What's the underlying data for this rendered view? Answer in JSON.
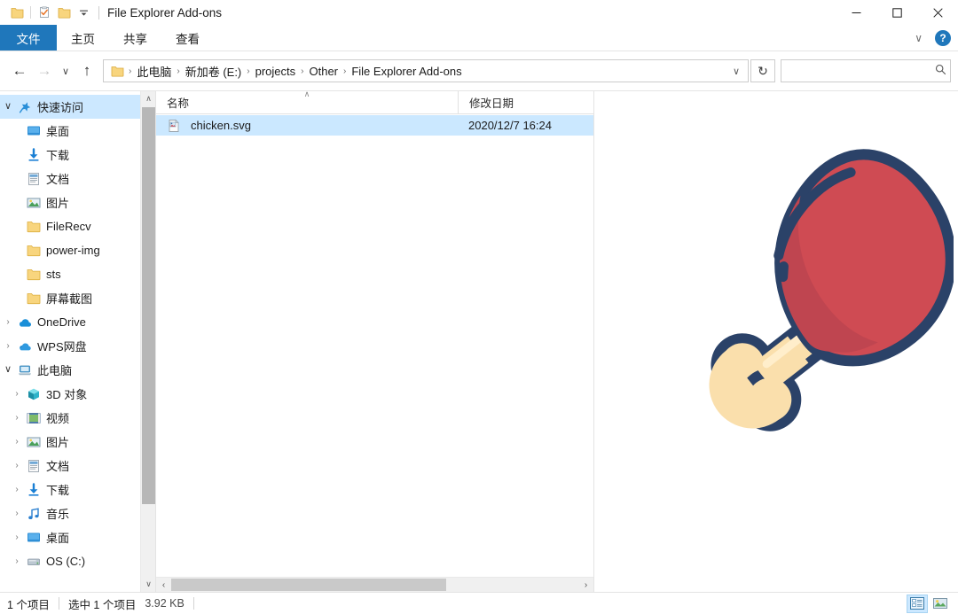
{
  "window": {
    "title": "File Explorer Add-ons",
    "quick_access_toolbar": [
      {
        "name": "folder-icon",
        "label": "文件夹"
      },
      {
        "name": "properties-icon",
        "label": "属性"
      },
      {
        "name": "new-folder-icon",
        "label": "新建文件夹"
      },
      {
        "name": "customize-dropdown-icon",
        "label": "自定义快速访问工具栏"
      }
    ],
    "controls": {
      "minimize": "—",
      "maximize": "☐",
      "close": "✕"
    }
  },
  "ribbon": {
    "tabs": [
      {
        "label": "文件",
        "active": true
      },
      {
        "label": "主页",
        "active": false
      },
      {
        "label": "共享",
        "active": false
      },
      {
        "label": "查看",
        "active": false
      }
    ],
    "expand_label": "∨",
    "help_label": "?"
  },
  "nav": {
    "back": "←",
    "forward": "→",
    "recent": "∨",
    "up": "↑",
    "breadcrumbs": [
      "此电脑",
      "新加卷 (E:)",
      "projects",
      "Other",
      "File Explorer Add-ons"
    ],
    "separator": "›",
    "address_dropdown": "∨",
    "refresh": "↻"
  },
  "search": {
    "value": "",
    "placeholder": "",
    "icon": "search-icon"
  },
  "sidebar": {
    "items": [
      {
        "label": "快速访问",
        "icon": "pin-star-icon",
        "twisty": "open",
        "depth": 0,
        "selected": true,
        "pinned": false
      },
      {
        "label": "桌面",
        "icon": "desktop-icon",
        "twisty": "none",
        "depth": 1,
        "selected": false,
        "pinned": true
      },
      {
        "label": "下载",
        "icon": "download-icon",
        "twisty": "none",
        "depth": 1,
        "selected": false,
        "pinned": true
      },
      {
        "label": "文档",
        "icon": "documents-icon",
        "twisty": "none",
        "depth": 1,
        "selected": false,
        "pinned": true
      },
      {
        "label": "图片",
        "icon": "pictures-icon",
        "twisty": "none",
        "depth": 1,
        "selected": false,
        "pinned": true
      },
      {
        "label": "FileRecv",
        "icon": "folder-icon",
        "twisty": "none",
        "depth": 1,
        "selected": false,
        "pinned": false
      },
      {
        "label": "power-img",
        "icon": "folder-icon",
        "twisty": "none",
        "depth": 1,
        "selected": false,
        "pinned": false
      },
      {
        "label": "sts",
        "icon": "folder-icon",
        "twisty": "none",
        "depth": 1,
        "selected": false,
        "pinned": false
      },
      {
        "label": "屏幕截图",
        "icon": "folder-icon",
        "twisty": "none",
        "depth": 1,
        "selected": false,
        "pinned": false
      },
      {
        "label": "OneDrive",
        "icon": "onedrive-icon",
        "twisty": "closed",
        "depth": 0,
        "selected": false,
        "pinned": false
      },
      {
        "label": "WPS网盘",
        "icon": "wps-cloud-icon",
        "twisty": "closed",
        "depth": 0,
        "selected": false,
        "pinned": false
      },
      {
        "label": "此电脑",
        "icon": "this-pc-icon",
        "twisty": "open",
        "depth": 0,
        "selected": false,
        "pinned": false
      },
      {
        "label": "3D 对象",
        "icon": "3d-objects-icon",
        "twisty": "closed",
        "depth": 1,
        "selected": false,
        "pinned": false
      },
      {
        "label": "视频",
        "icon": "videos-icon",
        "twisty": "closed",
        "depth": 1,
        "selected": false,
        "pinned": false
      },
      {
        "label": "图片",
        "icon": "pictures-icon",
        "twisty": "closed",
        "depth": 1,
        "selected": false,
        "pinned": false
      },
      {
        "label": "文档",
        "icon": "documents-icon",
        "twisty": "closed",
        "depth": 1,
        "selected": false,
        "pinned": false
      },
      {
        "label": "下载",
        "icon": "download-icon",
        "twisty": "closed",
        "depth": 1,
        "selected": false,
        "pinned": false
      },
      {
        "label": "音乐",
        "icon": "music-icon",
        "twisty": "closed",
        "depth": 1,
        "selected": false,
        "pinned": false
      },
      {
        "label": "桌面",
        "icon": "desktop-icon",
        "twisty": "closed",
        "depth": 1,
        "selected": false,
        "pinned": false
      },
      {
        "label": "OS (C:)",
        "icon": "drive-icon",
        "twisty": "closed",
        "depth": 1,
        "selected": false,
        "pinned": false
      }
    ],
    "scroll_up": "∧",
    "scroll_down": "∨"
  },
  "filelist": {
    "columns": [
      {
        "label": "名称",
        "sorted": true,
        "sort_dir": "asc"
      },
      {
        "label": "修改日期",
        "sorted": false,
        "sort_dir": ""
      }
    ],
    "sort_indicator": "∧",
    "rows": [
      {
        "name": "chicken.svg",
        "modified": "2020/12/7 16:24",
        "icon": "svg-file-icon",
        "selected": true
      }
    ],
    "hscroll_left": "‹",
    "hscroll_right": "›"
  },
  "preview": {
    "image_name": "chicken-drumstick-illustration",
    "colors": {
      "meat": "#cf4b53",
      "meat_shade": "#bf4550",
      "bone": "#fadfac",
      "bone_shade": "#f0cf95",
      "outline": "#2b4268"
    }
  },
  "statusbar": {
    "item_count": "1 个项目",
    "selection": "选中 1 个项目",
    "size": "3.92 KB",
    "views": [
      {
        "name": "details-view-button",
        "active": true
      },
      {
        "name": "large-icons-view-button",
        "active": false
      }
    ]
  },
  "theme": {
    "accent": "#1f77bb",
    "selection": "#cbe8ff",
    "tree_selection": "#cce8ff"
  }
}
